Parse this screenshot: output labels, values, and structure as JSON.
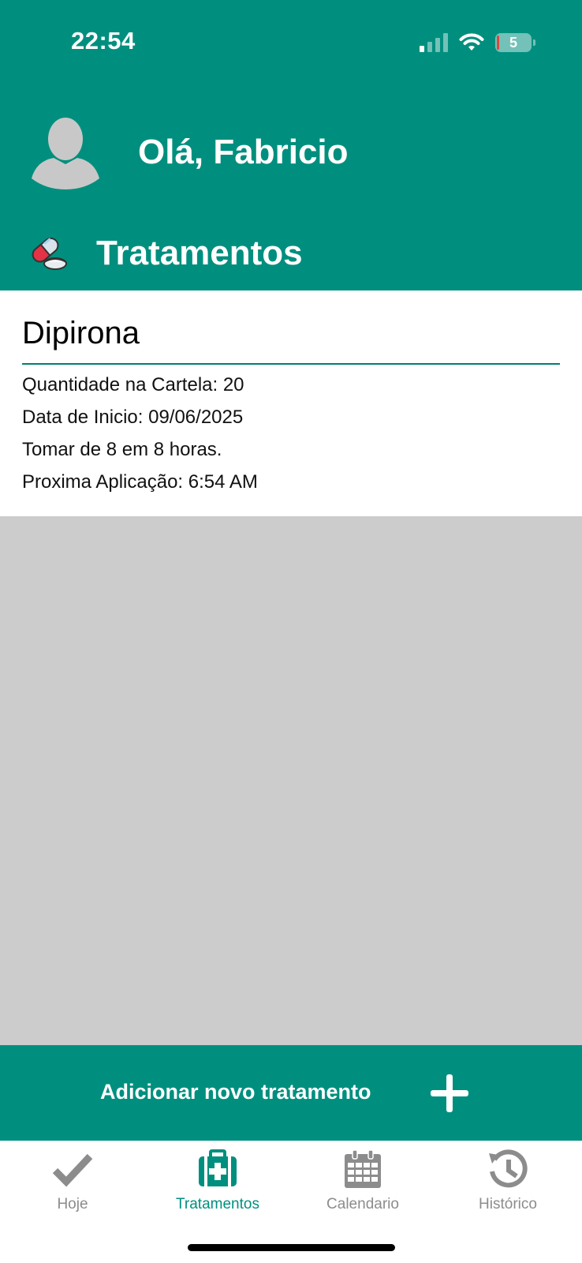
{
  "status_bar": {
    "time": "22:54",
    "battery_level": "5",
    "signal_bars_active": 1,
    "signal_bars_total": 4
  },
  "header": {
    "greeting": "Olá, Fabricio",
    "section_title": "Tratamentos",
    "avatar_icon": "user-silhouette-icon",
    "section_icon": "pill-icon"
  },
  "treatments": [
    {
      "name": "Dipirona",
      "quantity_text": "Quantidade na Cartela: 20",
      "start_date_text": "Data de Inicio: 09/06/2025",
      "frequency_text": "Tomar de 8 em 8 horas.",
      "next_dose_text": "Proxima Aplicação: 6:54 AM"
    }
  ],
  "add_button": {
    "label": "Adicionar novo tratamento",
    "icon": "plus-icon"
  },
  "tabs": [
    {
      "label": "Hoje",
      "icon": "checkmark-icon",
      "active": false
    },
    {
      "label": "Tratamentos",
      "icon": "medical-kit-icon",
      "active": true
    },
    {
      "label": "Calendario",
      "icon": "calendar-icon",
      "active": false
    },
    {
      "label": "Histórico",
      "icon": "history-icon",
      "active": false
    }
  ],
  "colors": {
    "primary": "#008F7E",
    "tab_inactive": "#8C8C8C",
    "background_empty": "#CCCCCC"
  }
}
